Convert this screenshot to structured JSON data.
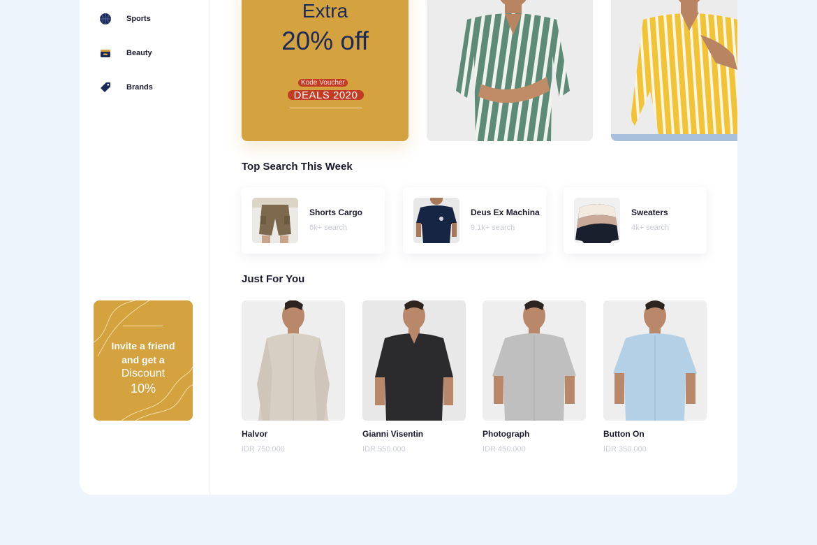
{
  "sidebar": {
    "items": [
      {
        "label": "Sports",
        "icon": "basketball-icon"
      },
      {
        "label": "Beauty",
        "icon": "wallet-icon"
      },
      {
        "label": "Brands",
        "icon": "tag-icon"
      }
    ],
    "invite": {
      "line1": "Invite a friend",
      "line2": "and get a",
      "line3": "Discount",
      "line4": "10%"
    }
  },
  "promo": {
    "extra": "Extra",
    "off": "20% off",
    "voucher_label": "Kode Voucher",
    "voucher_code": "DEALS 2020"
  },
  "top_search": {
    "title": "Top Search This Week",
    "items": [
      {
        "name": "Shorts Cargo",
        "count": "6k+ search"
      },
      {
        "name": "Deus Ex Machina",
        "count": "9.1k+ search"
      },
      {
        "name": "Sweaters",
        "count": "4k+ search"
      }
    ]
  },
  "just_for_you": {
    "title": "Just For You",
    "items": [
      {
        "name": "Halvor",
        "price": "IDR 750.000"
      },
      {
        "name": "Gianni Visentin",
        "price": "IDR 550.000"
      },
      {
        "name": "Photograph",
        "price": "IDR 450.000"
      },
      {
        "name": "Button On",
        "price": "IDR 350.000"
      }
    ]
  },
  "colors": {
    "accent": "#d4a23e",
    "navy": "#1c2a59",
    "voucher_red": "#c23b22",
    "page_bg": "#eef4fc"
  }
}
